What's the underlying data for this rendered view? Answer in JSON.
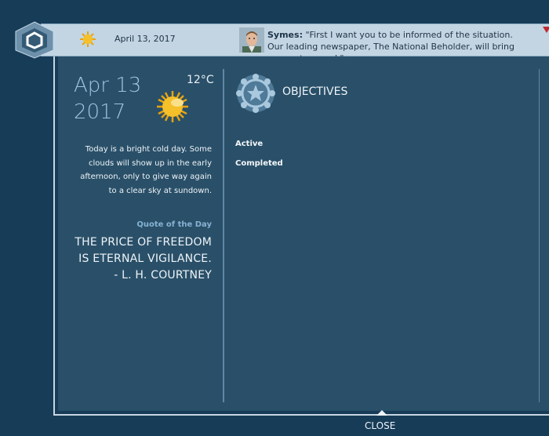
{
  "topbar": {
    "date": "April 13, 2017",
    "speaker": "Symes:",
    "message": "\"First I want you to be informed of the situation. Our leading newspaper, The National Beholder, will bring you up to speed.\""
  },
  "weather": {
    "date_line1": "Apr 13",
    "date_line2": "2017",
    "temperature": "12°C",
    "icon": "sun-icon",
    "description": "Today is a bright cold day. Some clouds will show up in the early afternoon, only to give way again to a clear sky at sundown."
  },
  "quote": {
    "label": "Quote of the Day",
    "line1": "THE PRICE OF FREEDOM",
    "line2": "IS ETERNAL VIGILANCE.",
    "author": "- L. H. COURTNEY"
  },
  "objectives": {
    "title": "OBJECTIVES",
    "filters": [
      "Active",
      "Completed"
    ]
  },
  "close_label": "CLOSE",
  "colors": {
    "background": "#173c58",
    "panel": "#2a5069",
    "topbar": "#c3d5e2",
    "accent": "#9cc4e0",
    "sun": "#f5c02a"
  }
}
